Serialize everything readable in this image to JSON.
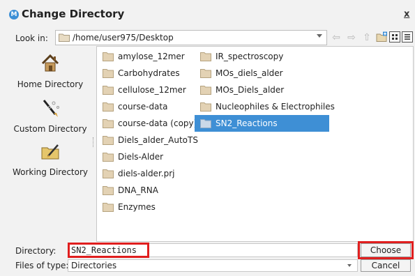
{
  "window": {
    "title": "Change Directory",
    "close_label": "x"
  },
  "lookin": {
    "label": "Look in:",
    "path": "/home/user975/Desktop"
  },
  "sidebar": {
    "items": [
      {
        "label": "Home Directory",
        "icon": "home-icon"
      },
      {
        "label": "Custom Directory",
        "icon": "custom-directory-icon"
      },
      {
        "label": "Working Directory",
        "icon": "working-directory-icon"
      }
    ]
  },
  "files": {
    "col1": [
      "amylose_12mer",
      "Carbohydrates",
      "cellulose_12mer",
      "course-data",
      "course-data (copy)",
      "Diels_alder_AutoTS",
      "Diels-Alder",
      "diels-alder.prj",
      "DNA_RNA",
      "Enzymes"
    ],
    "col2": [
      "IR_spectroscopy",
      "MOs_diels_alder",
      "MOs_Diels_alder",
      "Nucleophiles & Electrophiles",
      "SN2_Reactions"
    ],
    "selected": "SN2_Reactions"
  },
  "bottom": {
    "directory_label": "Directory:",
    "directory_value": "SN2_Reactions",
    "types_label": "Files of type:",
    "types_value": "Directories",
    "choose_label": "Choose",
    "cancel_label": "Cancel"
  },
  "colors": {
    "selection": "#3e8fd5",
    "highlight": "#e01e1e",
    "folder": "#e3d2b4"
  }
}
